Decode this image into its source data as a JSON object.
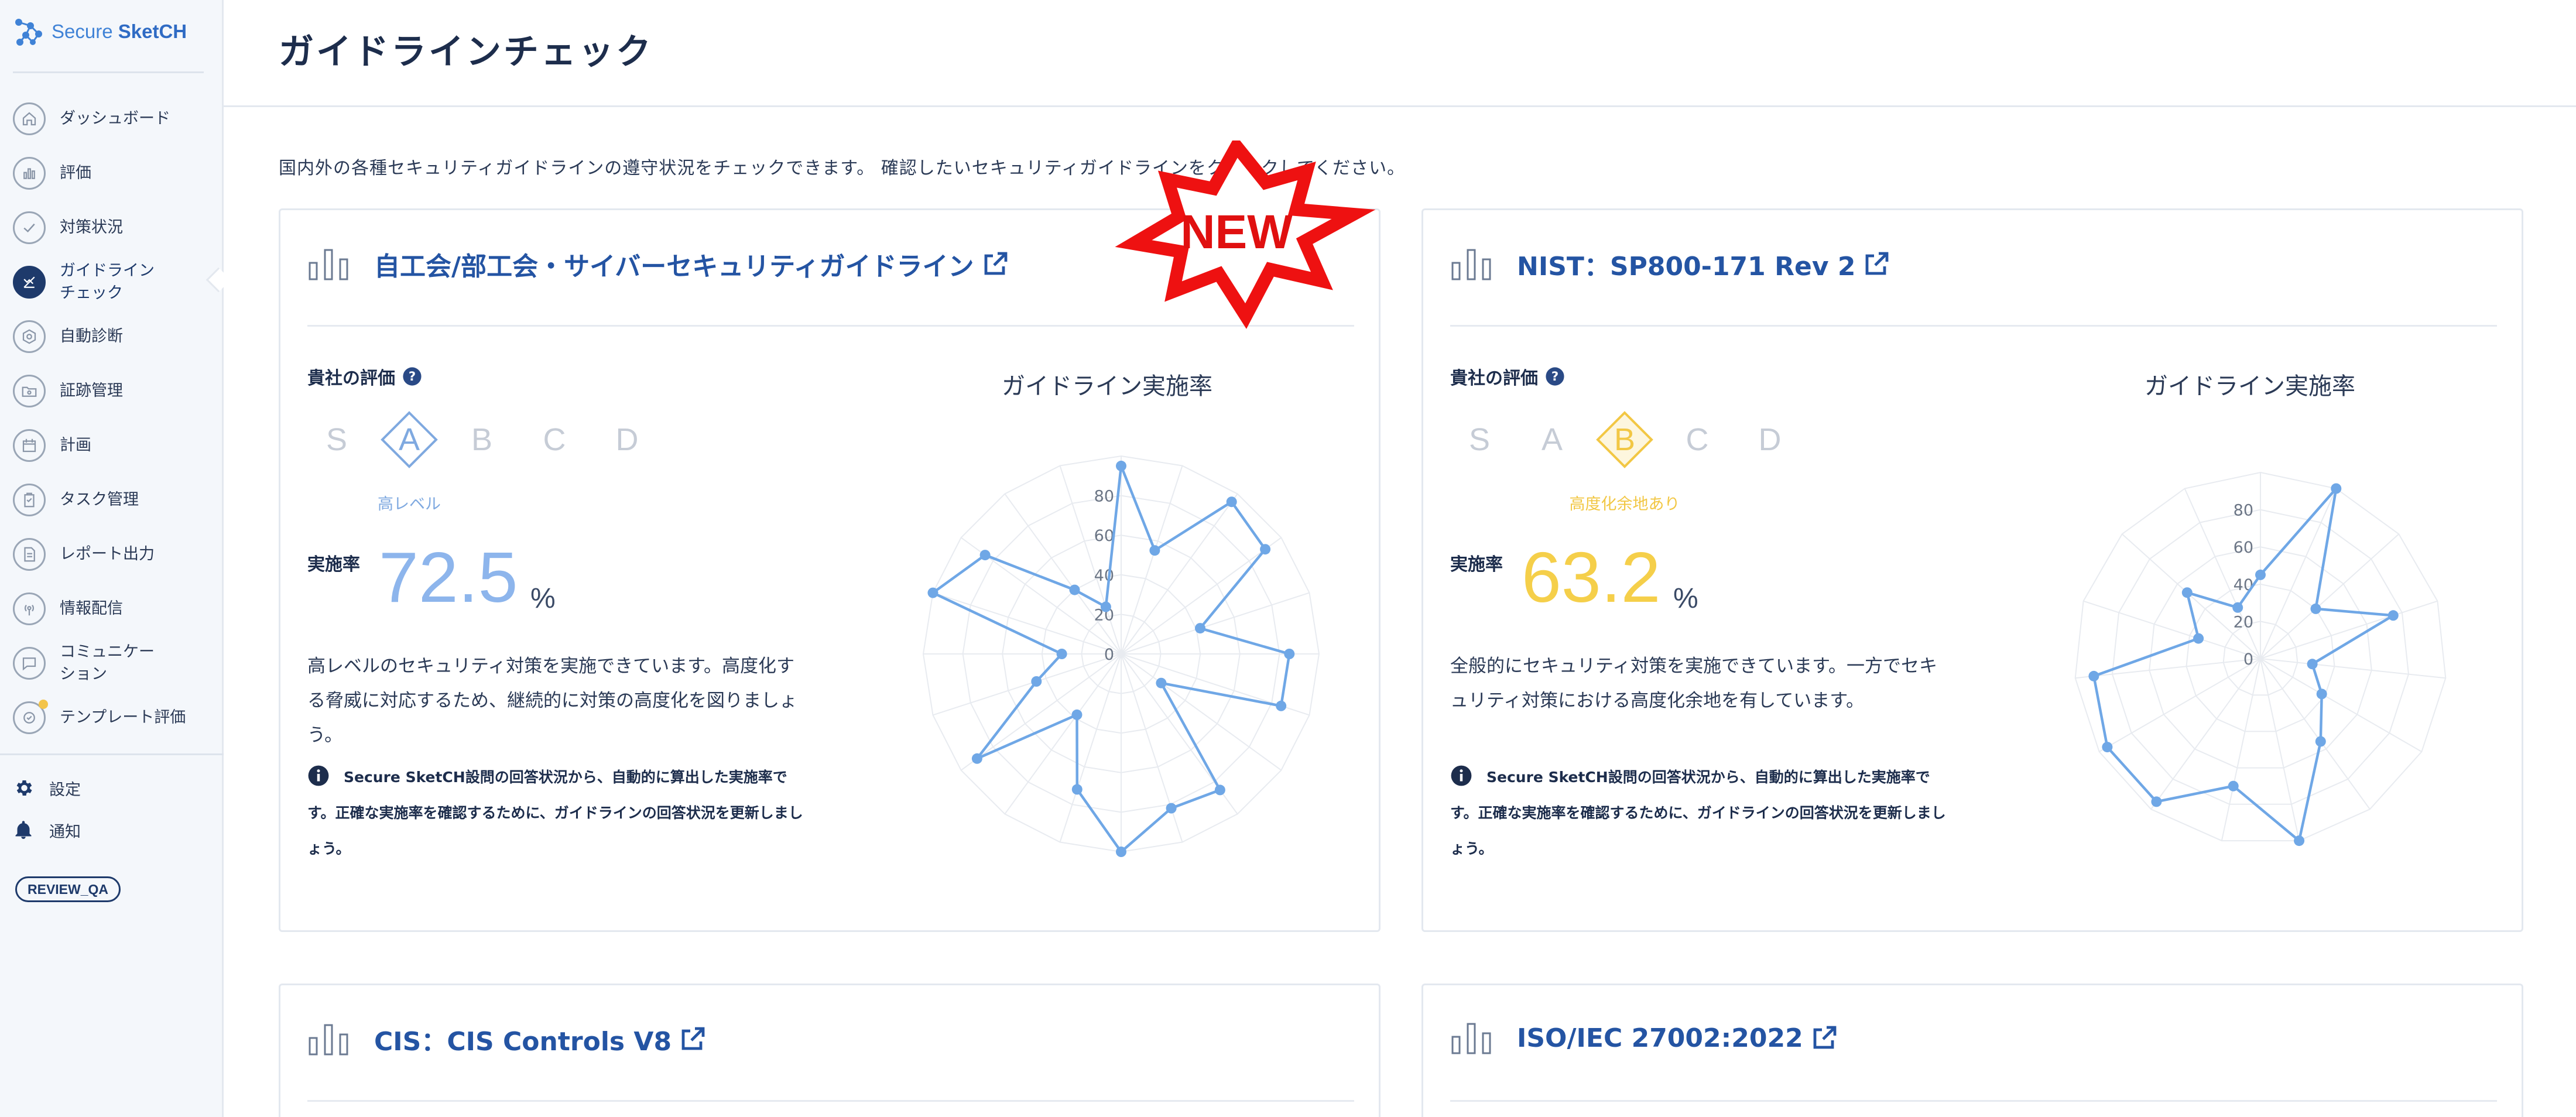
{
  "app": {
    "brand_light": "Secure ",
    "brand_bold": "SketCH"
  },
  "sidebar": {
    "items": [
      {
        "label": "ダッシュボード",
        "icon": "home-icon"
      },
      {
        "label": "評価",
        "icon": "chart-icon"
      },
      {
        "label": "対策状況",
        "icon": "check-icon"
      },
      {
        "label": "ガイドライン\nチェック",
        "icon": "guideline-icon",
        "active": true
      },
      {
        "label": "自動診断",
        "icon": "hexagon-icon"
      },
      {
        "label": "証跡管理",
        "icon": "folder-icon"
      },
      {
        "label": "計画",
        "icon": "calendar-icon"
      },
      {
        "label": "タスク管理",
        "icon": "clipboard-icon"
      },
      {
        "label": "レポート出力",
        "icon": "document-icon"
      },
      {
        "label": "情報配信",
        "icon": "broadcast-icon"
      },
      {
        "label": "コミュニケー\nション",
        "icon": "chat-icon"
      },
      {
        "label": "テンプレート評価",
        "icon": "template-icon"
      }
    ],
    "settings_label": "設定",
    "notify_label": "通知",
    "badge": "REVIEW_QA"
  },
  "page": {
    "title": "ガイドラインチェック",
    "intro": "国内外の各種セキュリティガイドラインの遵守状況をチェックできます。 確認したいセキュリティガイドラインをクリックしてください。",
    "new_badge": "NEW"
  },
  "common": {
    "eval_label": "貴社の評価",
    "rate_label": "実施率",
    "unit": "%",
    "radar_title": "ガイドライン実施率",
    "grades": [
      "S",
      "A",
      "B",
      "C",
      "D"
    ],
    "note": "Secure SketCH設問の回答状況から、自動的に算出した実施率です。正確な実施率を確認するために、ガイドラインの回答状況を更新しましょう。"
  },
  "cards": [
    {
      "title": "自工会/部工会・サイバーセキュリティガイドライン",
      "grade": "A",
      "grade_caption": "高レベル",
      "grade_color": "#7fa9e0",
      "rate": "72.5",
      "rate_color": "#8db5ec",
      "desc": "高レベルのセキュリティ対策を実施できています。高度化する脅威に対応するため、継続的に対策の高度化を図りましょう。"
    },
    {
      "title": "NIST：SP800-171 Rev 2",
      "grade": "B",
      "grade_caption": "高度化余地あり",
      "grade_color": "#f2c744",
      "rate": "63.2",
      "rate_color": "#f5cf4a",
      "desc": "全般的にセキュリティ対策を実施できています。一方でセキュリティ対策における高度化余地を有しています。"
    },
    {
      "title": "CIS：CIS Controls V8"
    },
    {
      "title": "ISO/IEC 27002:2022"
    }
  ],
  "chart_data": [
    {
      "type": "radar",
      "title": "ガイドライン実施率",
      "rlim": [
        0,
        100
      ],
      "tick_labels": [
        "0",
        "20",
        "40",
        "60",
        "80"
      ],
      "series": [
        {
          "values": [
            95,
            55,
            95,
            90,
            42,
            85,
            85,
            25,
            85,
            82,
            100,
            72,
            38,
            90,
            45,
            30,
            100,
            85,
            40,
            25
          ]
        }
      ]
    },
    {
      "type": "radar",
      "title": "ガイドライン実施率",
      "rlim": [
        0,
        100
      ],
      "tick_labels": [
        "0",
        "20",
        "40",
        "60",
        "80"
      ],
      "series": [
        {
          "values": [
            45,
            100,
            40,
            75,
            28,
            38,
            55,
            100,
            70,
            95,
            95,
            90,
            35,
            53,
            30
          ]
        }
      ]
    }
  ]
}
